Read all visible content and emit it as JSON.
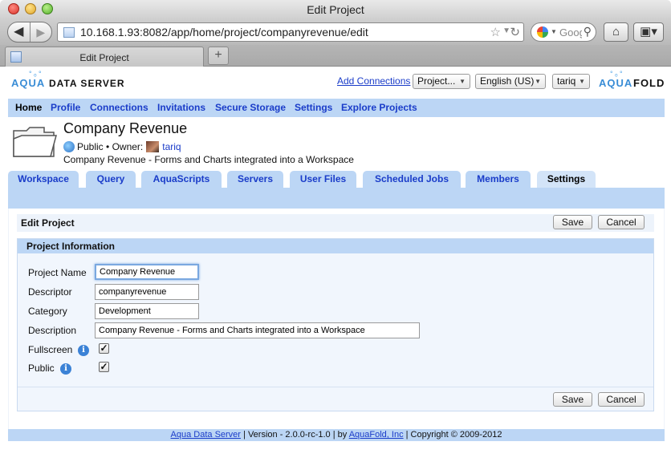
{
  "window": {
    "title": "Edit Project"
  },
  "browser": {
    "url": "10.168.1.93:8082/app/home/project/companyrevenue/edit",
    "search_placeholder": "Goog",
    "tab_title": "Edit Project"
  },
  "header": {
    "logo_left_a": "AQUA",
    "logo_left_b": "DATA SERVER",
    "logo_right_a": "AQUA",
    "logo_right_b": "FOLD",
    "add_connections": "Add Connections",
    "project_select": "Project...",
    "language_select": "English (US)",
    "user_select": "tariq"
  },
  "nav": {
    "items": [
      "Home",
      "Profile",
      "Connections",
      "Invitations",
      "Secure Storage",
      "Settings",
      "Explore Projects"
    ]
  },
  "project": {
    "title": "Company Revenue",
    "visibility": "Public",
    "owner_label": "Owner:",
    "owner": "tariq",
    "description": "Company Revenue - Forms and Charts integrated into a Workspace"
  },
  "tabs": [
    "Workspace",
    "Query",
    "AquaScripts",
    "Servers",
    "User Files",
    "Scheduled Jobs",
    "Members",
    "Settings"
  ],
  "form": {
    "heading": "Edit Project",
    "section": "Project Information",
    "save": "Save",
    "cancel": "Cancel",
    "labels": {
      "name": "Project Name",
      "descriptor": "Descriptor",
      "category": "Category",
      "description": "Description",
      "fullscreen": "Fullscreen",
      "public": "Public"
    },
    "values": {
      "name": "Company Revenue",
      "descriptor": "companyrevenue",
      "category": "Development",
      "description": "Company Revenue - Forms and Charts integrated into a Workspace"
    },
    "fullscreen_checked": true,
    "public_checked": true
  },
  "footer": {
    "product": "Aqua Data Server",
    "version": "| Version - 2.0.0-rc-1.0 | by",
    "company": "AquaFold, Inc",
    "copyright": "| Copyright © 2009-2012"
  }
}
